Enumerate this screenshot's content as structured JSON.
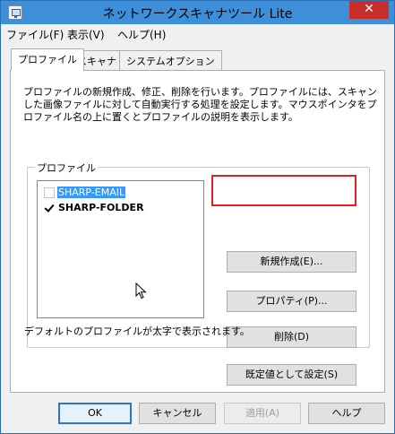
{
  "window": {
    "title": "ネットワークスキャナツール Lite",
    "close_label": "✕"
  },
  "menu": [
    "ファイル(F)",
    "表示(V)",
    "ヘルプ(H)"
  ],
  "tabs": [
    {
      "label": "プロファイル",
      "active": true
    },
    {
      "label": "スキャナ",
      "active": false
    },
    {
      "label": "システムオプション",
      "active": false
    }
  ],
  "profile": {
    "description": "プロファイルの新規作成、修正、削除を行います。プロファイルには、スキャンした画像ファイルに対して自動実行する処理を設定します。マウスポインタをプロファイル名の上に置くとプロファイルの説明を表示します。",
    "group_caption": "プロファイル",
    "items": [
      {
        "label": "SHARP-EMAIL",
        "checked": false,
        "selected": true,
        "bold": false
      },
      {
        "label": "SHARP-FOLDER",
        "checked": true,
        "selected": false,
        "bold": true
      }
    ],
    "note": "デフォルトのプロファイルが太字で表示されます。",
    "buttons": {
      "new": "新規作成(E)...",
      "properties": "プロパティ(P)...",
      "delete": "削除(D)",
      "set_default": "既定値として設定(S)"
    }
  },
  "dialog_buttons": {
    "ok": "OK",
    "cancel": "キャンセル",
    "apply": "適用(A)",
    "help": "ヘルプ"
  }
}
